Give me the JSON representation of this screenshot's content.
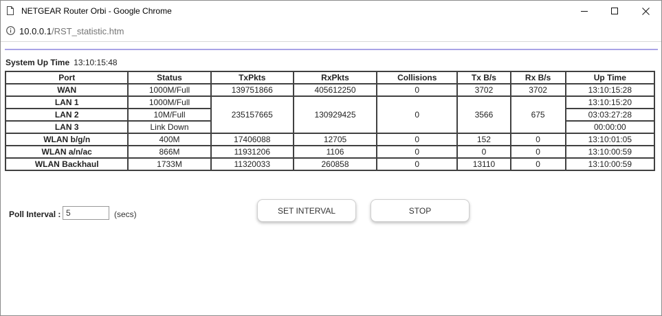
{
  "window": {
    "title": "NETGEAR Router Orbi - Google Chrome"
  },
  "address_bar": {
    "host": "10.0.0.1",
    "path": "/RST_statistic.htm"
  },
  "system_up_time": {
    "label": "System Up Time",
    "value": "13:10:15:48"
  },
  "stats_table": {
    "headers": [
      "Port",
      "Status",
      "TxPkts",
      "RxPkts",
      "Collisions",
      "Tx B/s",
      "Rx B/s",
      "Up Time"
    ],
    "wan": {
      "port": "WAN",
      "status": "1000M/Full",
      "txpkts": "139751866",
      "rxpkts": "405612250",
      "collisions": "0",
      "txbs": "3702",
      "rxbs": "3702",
      "uptime": "13:10:15:28"
    },
    "lan_group": {
      "txpkts": "235157665",
      "rxpkts": "130929425",
      "collisions": "0",
      "txbs": "3566",
      "rxbs": "675",
      "rows": [
        {
          "port": "LAN 1",
          "status": "1000M/Full",
          "uptime": "13:10:15:20"
        },
        {
          "port": "LAN 2",
          "status": "10M/Full",
          "uptime": "03:03:27:28"
        },
        {
          "port": "LAN 3",
          "status": "Link Down",
          "uptime": "00:00:00"
        }
      ]
    },
    "wlan_rows": [
      {
        "port": "WLAN b/g/n",
        "status": "400M",
        "txpkts": "17406088",
        "rxpkts": "12705",
        "collisions": "0",
        "txbs": "152",
        "rxbs": "0",
        "uptime": "13:10:01:05"
      },
      {
        "port": "WLAN a/n/ac",
        "status": "866M",
        "txpkts": "11931206",
        "rxpkts": "1106",
        "collisions": "0",
        "txbs": "0",
        "rxbs": "0",
        "uptime": "13:10:00:59"
      },
      {
        "port": "WLAN Backhaul",
        "status": "1733M",
        "txpkts": "11320033",
        "rxpkts": "260858",
        "collisions": "0",
        "txbs": "13110",
        "rxbs": "0",
        "uptime": "13:10:00:59"
      }
    ]
  },
  "poll": {
    "label": "Poll Interval :",
    "value": "5",
    "unit": "(secs)"
  },
  "buttons": {
    "set_interval": "SET INTERVAL",
    "stop": "STOP"
  },
  "colors": {
    "accent_line": "#a9a3e6",
    "table_border": "#404040"
  }
}
